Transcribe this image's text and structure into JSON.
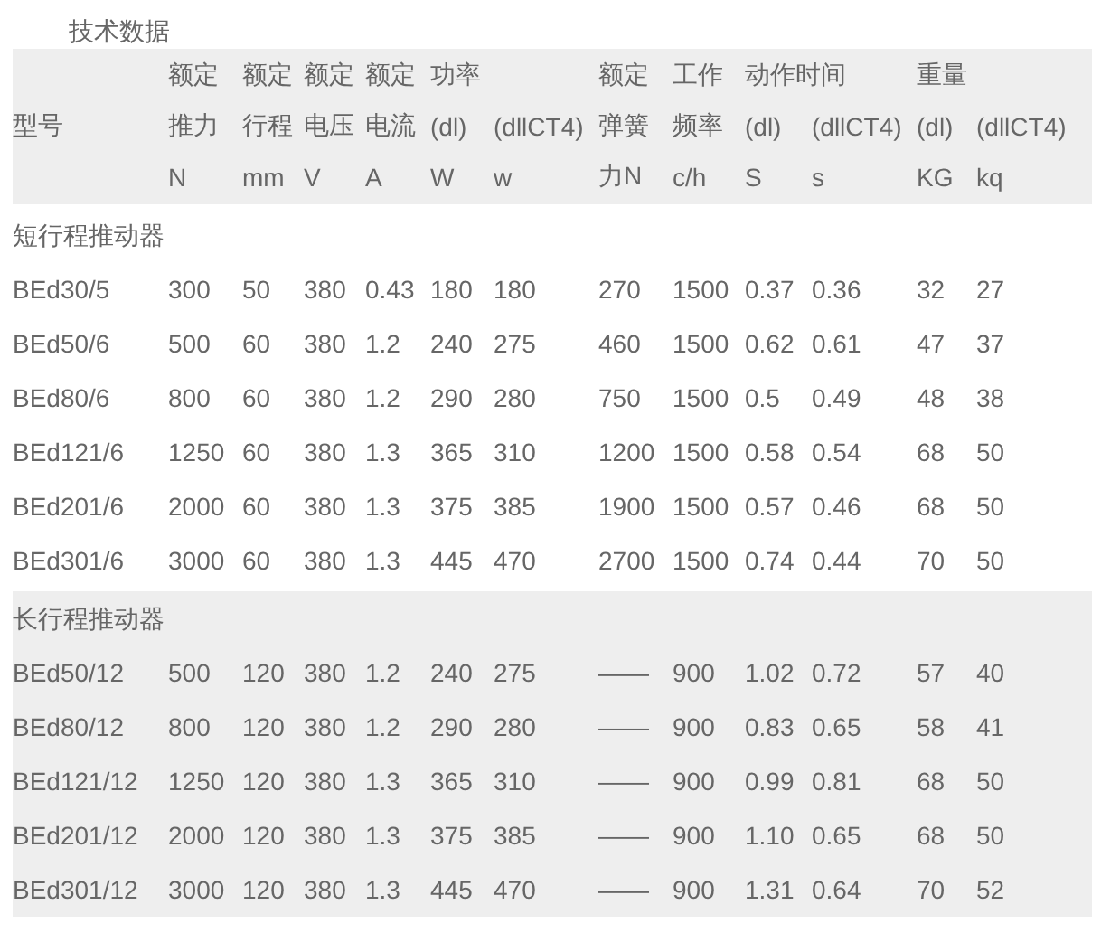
{
  "title": "技术数据",
  "columns": [
    {
      "middle": "型号"
    },
    {
      "top": "额定",
      "middle": "推力",
      "bottom": "N"
    },
    {
      "top": "额定",
      "middle": "行程",
      "bottom": "mm"
    },
    {
      "top": "额定",
      "middle": "电压",
      "bottom": "V"
    },
    {
      "top": "额定",
      "middle": "电流",
      "bottom": "A"
    },
    {
      "top": "功率",
      "middle": "(dl)",
      "bottom": "W"
    },
    {
      "middle": "(dllCT4)",
      "bottom": "w"
    },
    {
      "top": "额定",
      "middle": "弹簧",
      "bottom": "力N"
    },
    {
      "top": "工作",
      "middle": "频率",
      "bottom": "c/h"
    },
    {
      "top": "动作时间",
      "middle": "(dl)",
      "bottom": "S"
    },
    {
      "middle": "(dllCT4)",
      "bottom": "s"
    },
    {
      "top": "重量",
      "middle": "(dl)",
      "bottom": "KG"
    },
    {
      "middle": "(dllCT4)",
      "bottom": "kq"
    }
  ],
  "sections": [
    {
      "title": "短行程推动器",
      "shaded": false,
      "rows": [
        [
          "BEd30/5",
          "300",
          "50",
          "380",
          "0.43",
          "180",
          "180",
          "270",
          "1500",
          "0.37",
          "0.36",
          "32",
          "27"
        ],
        [
          "BEd50/6",
          "500",
          "60",
          "380",
          "1.2",
          "240",
          "275",
          "460",
          "1500",
          "0.62",
          "0.61",
          "47",
          "37"
        ],
        [
          "BEd80/6",
          "800",
          "60",
          "380",
          "1.2",
          "290",
          "280",
          "750",
          "1500",
          "0.5",
          "0.49",
          "48",
          "38"
        ],
        [
          "BEd121/6",
          "1250",
          "60",
          "380",
          "1.3",
          "365",
          "310",
          "1200",
          "1500",
          "0.58",
          "0.54",
          "68",
          "50"
        ],
        [
          "BEd201/6",
          "2000",
          "60",
          "380",
          "1.3",
          "375",
          "385",
          "1900",
          "1500",
          "0.57",
          "0.46",
          "68",
          "50"
        ],
        [
          "BEd301/6",
          "3000",
          "60",
          "380",
          "1.3",
          "445",
          "470",
          "2700",
          "1500",
          "0.74",
          "0.44",
          "70",
          "50"
        ]
      ]
    },
    {
      "title": "长行程推动器",
      "shaded": true,
      "rows": [
        [
          "BEd50/12",
          "500",
          "120",
          "380",
          "1.2",
          "240",
          "275",
          "——",
          "900",
          "1.02",
          "0.72",
          "57",
          "40"
        ],
        [
          "BEd80/12",
          "800",
          "120",
          "380",
          "1.2",
          "290",
          "280",
          "——",
          "900",
          "0.83",
          "0.65",
          "58",
          "41"
        ],
        [
          "BEd121/12",
          "1250",
          "120",
          "380",
          "1.3",
          "365",
          "310",
          "——",
          "900",
          "0.99",
          "0.81",
          "68",
          "50"
        ],
        [
          "BEd201/12",
          "2000",
          "120",
          "380",
          "1.3",
          "375",
          "385",
          "——",
          "900",
          "1.10",
          "0.65",
          "68",
          "50"
        ],
        [
          "BEd301/12",
          "3000",
          "120",
          "380",
          "1.3",
          "445",
          "470",
          "——",
          "900",
          "1.31",
          "0.64",
          "70",
          "52"
        ]
      ]
    }
  ]
}
